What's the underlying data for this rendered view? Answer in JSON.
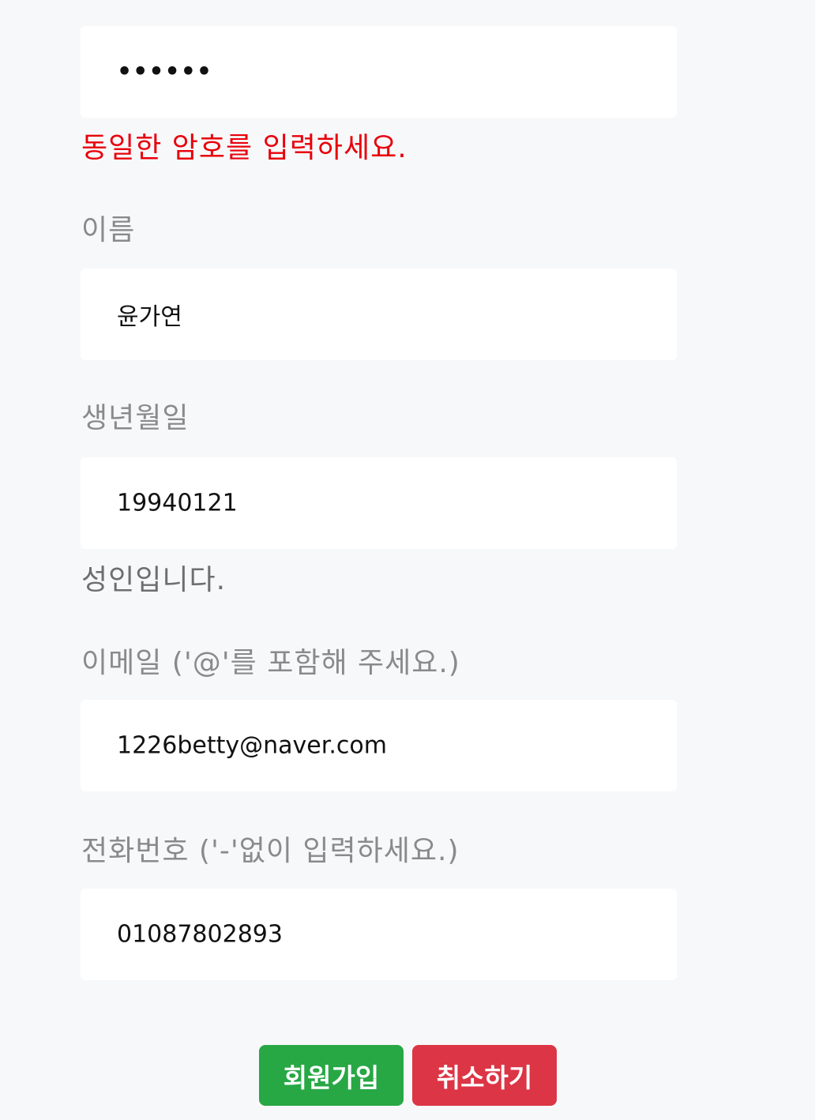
{
  "form": {
    "password_confirm": {
      "value_masked": "••••••",
      "error": "동일한 암호를 입력하세요."
    },
    "name": {
      "label": "이름",
      "value": "윤가연"
    },
    "birthdate": {
      "label": "생년월일",
      "value": "19940121",
      "info": "성인입니다."
    },
    "email": {
      "label": "이메일 ('@'를 포함해 주세요.)",
      "value": "1226betty@naver.com"
    },
    "phone": {
      "label": "전화번호 ('-'없이 입력하세요.)",
      "value": "01087802893"
    }
  },
  "buttons": {
    "signup_label": "회원가입",
    "cancel_label": "취소하기"
  },
  "colors": {
    "background": "#f7f8fa",
    "error": "#e8000b",
    "signup": "#28a745",
    "cancel": "#dc3545"
  }
}
